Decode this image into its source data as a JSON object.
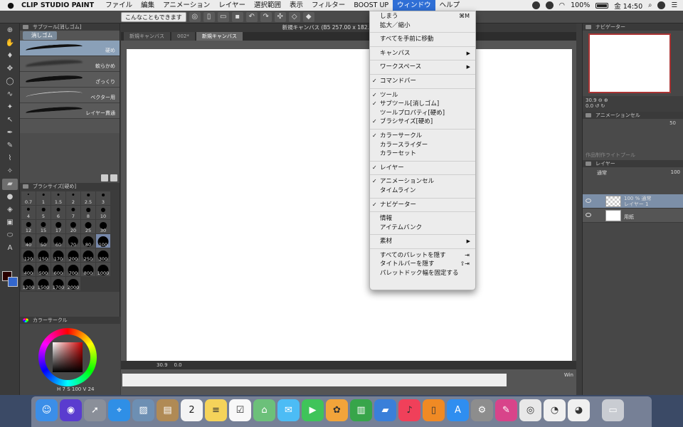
{
  "menubar": {
    "app_name": "CLIP STUDIO PAINT",
    "items": [
      "ファイル",
      "編集",
      "アニメーション",
      "レイヤー",
      "選択範囲",
      "表示",
      "フィルター",
      "BOOST UP",
      "ウィンドウ",
      "ヘルプ"
    ],
    "active_item": "ウィンドウ",
    "battery": "100%",
    "clock": "金 14:50"
  },
  "commandbar": {
    "tip_button": "こんなこともできます"
  },
  "subtool_panel": {
    "title": "サブツール[消しゴム]",
    "active_tab": "消しゴム",
    "brushes": [
      {
        "name": "硬め"
      },
      {
        "name": "軟らかめ"
      },
      {
        "name": "ざっくり"
      },
      {
        "name": "ベクター用"
      },
      {
        "name": "レイヤー貫通"
      }
    ]
  },
  "brushsize_panel": {
    "title": "ブラシサイズ[硬め]",
    "sizes": [
      "0.7",
      "1",
      "1.5",
      "2",
      "2.5",
      "3",
      "4",
      "5",
      "6",
      "7",
      "8",
      "10",
      "12",
      "15",
      "17",
      "20",
      "25",
      "30",
      "40",
      "50",
      "60",
      "70",
      "80",
      "100",
      "120",
      "150",
      "170",
      "200",
      "250",
      "300",
      "400",
      "500",
      "600",
      "700",
      "800",
      "1000",
      "1200",
      "1500",
      "1700",
      "2000"
    ],
    "selected": "100"
  },
  "color_panel": {
    "title": "カラーサークル",
    "readout_h": "7",
    "readout_s": "100",
    "readout_v": "24"
  },
  "canvas": {
    "title": "新規キャンバス (B5 257.00 x 182.00mm 600dpi 30",
    "tabs": [
      "新規キャンバス",
      "002*",
      "新規キャンバス"
    ],
    "active_tab_index": 2,
    "zoom": "30.9",
    "angle": "0.0",
    "bottom_label": "Win"
  },
  "navigator_panel": {
    "title": "ナビゲーター",
    "zoom": "30.9",
    "angle": "0.0"
  },
  "anim_panel": {
    "title": "アニメーションセル",
    "value": "50",
    "placeholder": "作品制作ライトプール"
  },
  "layer_panel": {
    "title": "レイヤー",
    "blend_mode": "通常",
    "opacity": "100",
    "layers": [
      {
        "line1": "100 % 通常",
        "line2": "レイヤー 1"
      },
      {
        "line1": "",
        "line2": "用紙"
      }
    ]
  },
  "window_menu": {
    "items": [
      {
        "label": "しまう",
        "check": false,
        "shortcut": "⌘M",
        "submenu": false
      },
      {
        "label": "拡大／縮小",
        "check": false,
        "shortcut": "",
        "submenu": false
      },
      {
        "sep": true
      },
      {
        "label": "すべてを手前に移動",
        "check": false,
        "shortcut": "",
        "submenu": false
      },
      {
        "sep": true
      },
      {
        "label": "キャンバス",
        "check": false,
        "shortcut": "",
        "submenu": true
      },
      {
        "sep": true
      },
      {
        "label": "ワークスペース",
        "check": false,
        "shortcut": "",
        "submenu": true
      },
      {
        "sep": true
      },
      {
        "label": "コマンドバー",
        "check": true,
        "shortcut": "",
        "submenu": false
      },
      {
        "sep": true
      },
      {
        "label": "ツール",
        "check": true,
        "shortcut": "",
        "submenu": false
      },
      {
        "label": "サブツール[消しゴム]",
        "check": true,
        "shortcut": "",
        "submenu": false
      },
      {
        "label": "ツールプロパティ[硬め]",
        "check": false,
        "shortcut": "",
        "submenu": false
      },
      {
        "label": "ブラシサイズ[硬め]",
        "check": true,
        "shortcut": "",
        "submenu": false
      },
      {
        "sep": true
      },
      {
        "label": "カラーサークル",
        "check": true,
        "shortcut": "",
        "submenu": false
      },
      {
        "label": "カラースライダー",
        "check": false,
        "shortcut": "",
        "submenu": false
      },
      {
        "label": "カラーセット",
        "check": false,
        "shortcut": "",
        "submenu": false
      },
      {
        "sep": true
      },
      {
        "label": "レイヤー",
        "check": true,
        "shortcut": "",
        "submenu": false
      },
      {
        "sep": true
      },
      {
        "label": "アニメーションセル",
        "check": true,
        "shortcut": "",
        "submenu": false
      },
      {
        "label": "タイムライン",
        "check": false,
        "shortcut": "",
        "submenu": false
      },
      {
        "sep": true
      },
      {
        "label": "ナビゲーター",
        "check": true,
        "shortcut": "",
        "submenu": false
      },
      {
        "sep": true
      },
      {
        "label": "情報",
        "check": false,
        "shortcut": "",
        "submenu": false
      },
      {
        "label": "アイテムバンク",
        "check": false,
        "shortcut": "",
        "submenu": false
      },
      {
        "sep": true
      },
      {
        "label": "素材",
        "check": false,
        "shortcut": "",
        "submenu": true
      },
      {
        "sep": true
      },
      {
        "label": "すべてのパレットを隠す",
        "check": false,
        "shortcut": "⇥",
        "submenu": false
      },
      {
        "label": "タイトルバーを隠す",
        "check": false,
        "shortcut": "⇧⇥",
        "submenu": false
      },
      {
        "label": "パレットドック幅を固定する",
        "check": false,
        "shortcut": "",
        "submenu": false
      }
    ]
  },
  "dock": {
    "calendar_day": "2",
    "apps": [
      {
        "name": "finder-icon",
        "color": "#3b8ee8"
      },
      {
        "name": "siri-icon",
        "color": "#5a3ccf"
      },
      {
        "name": "launchpad-icon",
        "color": "#8a8f99"
      },
      {
        "name": "safari-icon",
        "color": "#2f8fe6"
      },
      {
        "name": "preview-icon",
        "color": "#6d8fb3"
      },
      {
        "name": "notebook-icon",
        "color": "#b08a55"
      },
      {
        "name": "calendar-icon",
        "color": "#f4f4f4"
      },
      {
        "name": "notes-icon",
        "color": "#f5d35a"
      },
      {
        "name": "reminders-icon",
        "color": "#f8f8f8"
      },
      {
        "name": "maps-icon",
        "color": "#6cc07a"
      },
      {
        "name": "messages-icon",
        "color": "#4cbcf5"
      },
      {
        "name": "facetime-icon",
        "color": "#3fc45a"
      },
      {
        "name": "photos-icon",
        "color": "#f2a43a"
      },
      {
        "name": "numbers-icon",
        "color": "#37a54a"
      },
      {
        "name": "keynote-icon",
        "color": "#3a7fd9"
      },
      {
        "name": "music-icon",
        "color": "#f0405a"
      },
      {
        "name": "books-icon",
        "color": "#f08a24"
      },
      {
        "name": "appstore-icon",
        "color": "#2f8ef0"
      },
      {
        "name": "preferences-icon",
        "color": "#8d8d8d"
      },
      {
        "name": "clipstudio-paint-icon",
        "color": "#d8448a"
      },
      {
        "name": "clipstudio-icon",
        "color": "#e8e8e8"
      },
      {
        "name": "clipstudio-modeler-icon",
        "color": "#f0f0f0"
      },
      {
        "name": "clipstudio-extra-icon",
        "color": "#f0f0f0"
      },
      {
        "name": "trash-icon",
        "color": "#c9ccd2"
      }
    ]
  }
}
